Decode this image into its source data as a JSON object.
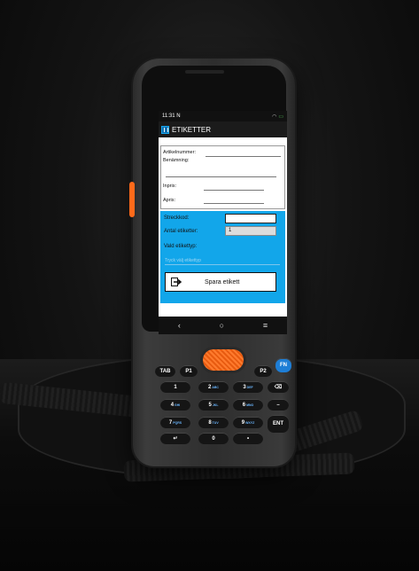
{
  "statusbar": {
    "time": "11:31",
    "carrier_mark": "N"
  },
  "app": {
    "title": "ETIKETTER"
  },
  "form": {
    "article_label": "Artikelnummer:",
    "name_label": "Benämning:",
    "purchase_price_label": "Inpris:",
    "price_label": "Apris:"
  },
  "label_panel": {
    "barcode_label": "Streckkod:",
    "barcode_value": "",
    "count_label": "Antal etiketter:",
    "count_value": "1",
    "type_label": "Vald etikettyp:",
    "type_placeholder": "Tryck välj etikettyp",
    "save_label": "Spara etikett"
  },
  "navbar": {
    "back": "‹",
    "home": "○",
    "menu": "≡"
  },
  "keypad": {
    "tab": "TAB",
    "p1": "P1",
    "p2": "P2",
    "fn": "FN",
    "ent": "ENT",
    "k1": "1",
    "k2": "2",
    "k3": "3",
    "k4": "4",
    "k5": "5",
    "k6": "6",
    "k7": "7",
    "k8": "8",
    "k9": "9",
    "k0": "0",
    "sub2": "ABC",
    "sub3": "DEF",
    "sub4": "GHI",
    "sub5": "JKL",
    "sub6": "MNO",
    "sub7": "PQRS",
    "sub8": "TUV",
    "sub9": "WXYZ"
  },
  "colors": {
    "accent_blue": "#12a6ea",
    "scan_orange": "#ff7b2e"
  }
}
